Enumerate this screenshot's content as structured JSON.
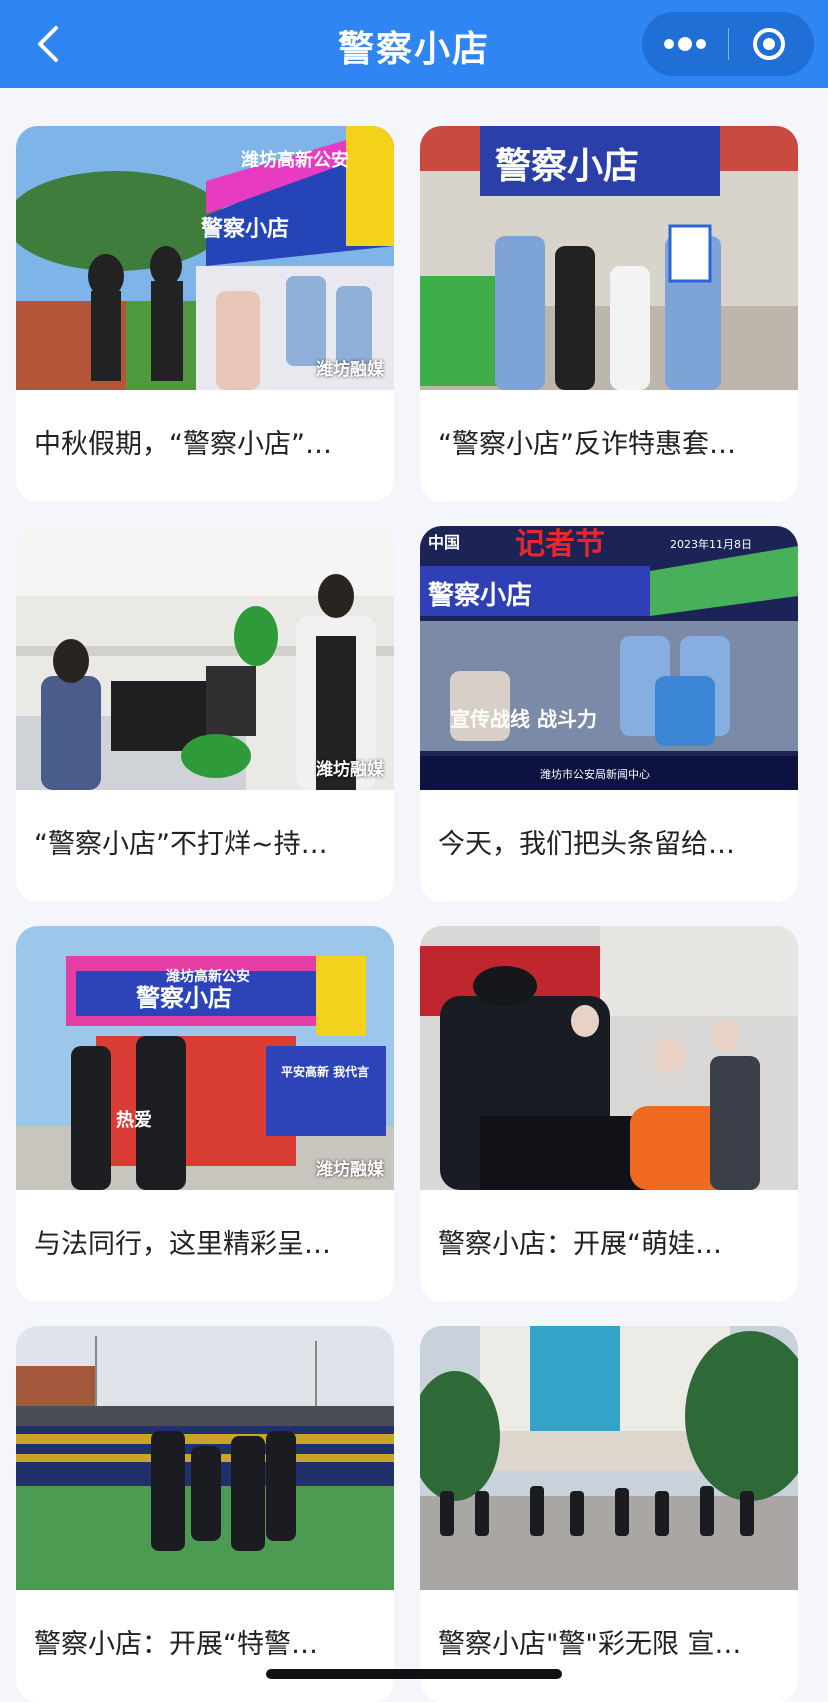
{
  "nav": {
    "title": "警察小店"
  },
  "cards": [
    {
      "caption": "中秋假期，“警察小店”…",
      "watermark": "潍坊融媒",
      "thumb_text": [
        "潍坊高新公安",
        "警察小店"
      ]
    },
    {
      "caption": "“警察小店”反诈特惠套…",
      "watermark": "",
      "thumb_text": [
        "警察小店"
      ]
    },
    {
      "caption": "“警察小店”不打烊~持…",
      "watermark": "潍坊融媒",
      "thumb_text": []
    },
    {
      "caption": "今天，我们把头条留给…",
      "watermark": "",
      "thumb_text": [
        "中国",
        "记者节",
        "2023年11月8日",
        "警察小店",
        "宣传战线 战斗力",
        "潍坊市公安局新闻中心"
      ]
    },
    {
      "caption": "与法同行，这里精彩呈…",
      "watermark": "潍坊融媒",
      "thumb_text": [
        "潍坊高新公安",
        "警察小店",
        "平安高新 我代言",
        "热爱"
      ]
    },
    {
      "caption": "警察小店：开展“萌娃…",
      "watermark": "",
      "thumb_text": []
    },
    {
      "caption": "警察小店：开展“特警…",
      "watermark": "",
      "thumb_text": []
    },
    {
      "caption": "警察小店\"警\"彩无限 宣…",
      "watermark": "",
      "thumb_text": []
    }
  ],
  "colors": {
    "nav_bg": "#2f86f2",
    "capsule_bg": "#1f6fd6",
    "page_bg": "#f4f6fb",
    "card_bg": "#ffffff",
    "caption_text": "#222222"
  },
  "icons": [
    "back-chevron-icon",
    "more-dots-icon",
    "close-target-icon"
  ]
}
